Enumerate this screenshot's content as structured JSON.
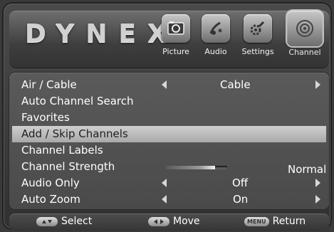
{
  "brand": {
    "logo_text": "DYNEX"
  },
  "categories": [
    {
      "label": "Picture",
      "icon": "picture-icon"
    },
    {
      "label": "Audio",
      "icon": "audio-icon"
    },
    {
      "label": "Settings",
      "icon": "settings-icon"
    },
    {
      "label": "Channel",
      "icon": "channel-icon",
      "active": true
    }
  ],
  "menu": {
    "selected_index": 3,
    "items": [
      {
        "label": "Air / Cable",
        "value": "Cable",
        "arrows": true
      },
      {
        "label": "Auto Channel Search"
      },
      {
        "label": "Favorites"
      },
      {
        "label": "Add / Skip Channels"
      },
      {
        "label": "Channel Labels"
      },
      {
        "label": "Channel Strength",
        "value": "Normal",
        "level": 0.8
      },
      {
        "label": "Audio Only",
        "value": "Off",
        "arrows": true
      },
      {
        "label": "Auto Zoom",
        "value": "On",
        "arrows": true
      }
    ]
  },
  "footer": {
    "select_label": "Select",
    "move_label": "Move",
    "menu_key": "MENU",
    "return_label": "Return"
  },
  "colors": {
    "highlight": "#bdbdbd",
    "text": "#ffffff",
    "panel": "#505050"
  }
}
